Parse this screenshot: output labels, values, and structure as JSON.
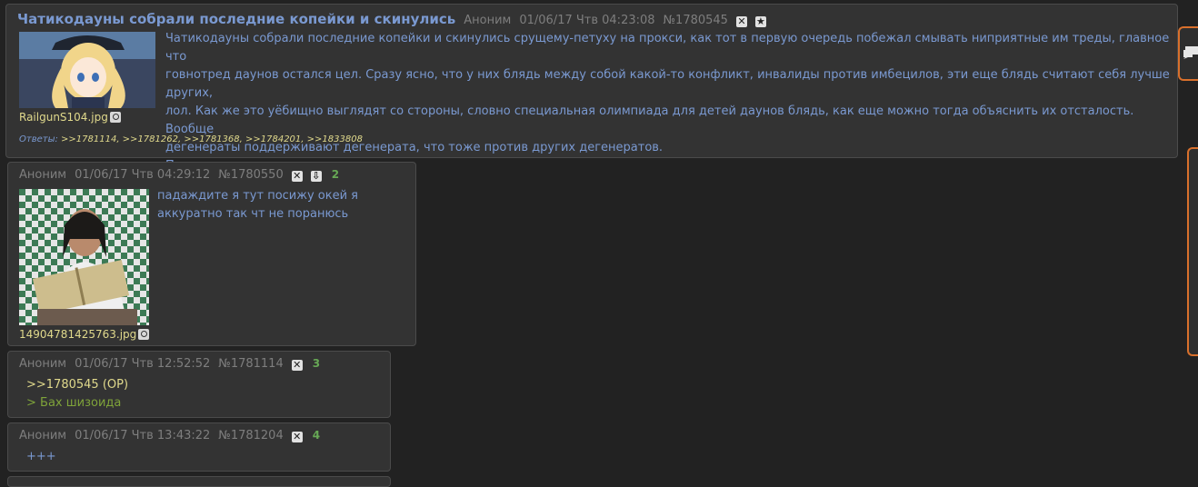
{
  "op": {
    "title": "Чатикодауны собрали последние копейки и скинулись",
    "author": "Аноним",
    "date": "01/06/17 Чтв 04:23:08",
    "num": "№1780545",
    "file_name": "RailgunS104.jpg",
    "body_lines": [
      "Чатикодауны собрали последние копейки и скинулись срущему-петуху на прокси, как тот в первую очередь побежал смывать ниприятные им треды, главное что",
      "говнотред даунов остался цел. Сразу ясно, что у них блядь между собой какой-то конфликт, инвалиды против имбецилов, эти еще блядь считают себя лучше других,",
      "лол. Как же это уёбищно выглядят со стороны, словно специальная олимпиада для детей даунов блядь, как еще можно тогда объяснить их отсталость. Вообще",
      "дегенераты поддерживают дегенерата, что тоже против других дегенератов.",
      "Печальное зрелище."
    ],
    "replies_label": "Ответы:",
    "replies": ">>1781114, >>1781262, >>1781368, >>1784201, >>1833808"
  },
  "posts": [
    {
      "author": "Аноним",
      "date": "01/06/17 Чтв 04:29:12",
      "num": "№1780550",
      "count": "2",
      "file_name": "14904781425763.jpg",
      "body_lines": [
        "падаждите я тут посижу окей я",
        "аккуратно так чт не поранюсь"
      ]
    },
    {
      "author": "Аноним",
      "date": "01/06/17 Чтв 12:52:52",
      "num": "№1781114",
      "count": "3",
      "link": ">>1780545 (OP)",
      "quote": "> Бах шизоида"
    },
    {
      "author": "Аноним",
      "date": "01/06/17 Чтв 13:43:22",
      "num": "№1781204",
      "count": "4",
      "text": "+++"
    }
  ]
}
